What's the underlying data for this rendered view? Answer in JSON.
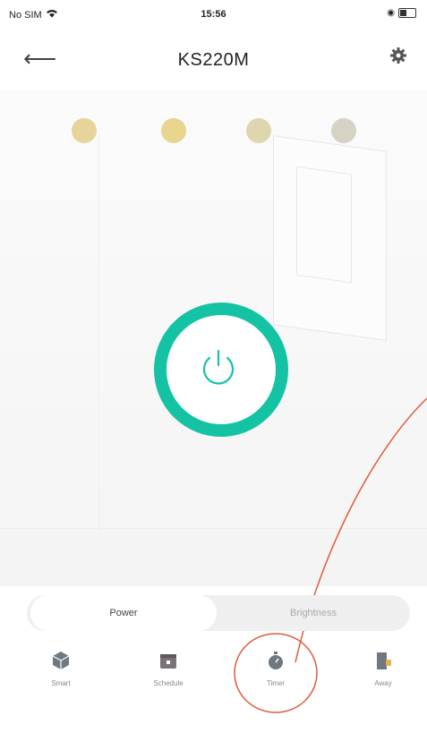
{
  "status_bar": {
    "carrier": "No SIM",
    "time": "15:56"
  },
  "header": {
    "title": "KS220M",
    "back_icon": "arrow-left-icon",
    "settings_icon": "gear-icon"
  },
  "indicator_dots": [
    "#e6d49a",
    "#e8d58e",
    "#dfd6b0",
    "#d7d3c4"
  ],
  "power": {
    "accent_color": "#14c2a4",
    "icon": "power-icon"
  },
  "tabs": [
    {
      "label": "Power",
      "selected": true
    },
    {
      "label": "Brightness",
      "selected": false
    }
  ],
  "bottom_nav": [
    {
      "label": "Smart",
      "icon": "smart-cube-icon"
    },
    {
      "label": "Schedule",
      "icon": "calendar-icon"
    },
    {
      "label": "Timer",
      "icon": "stopwatch-icon"
    },
    {
      "label": "Away",
      "icon": "away-door-icon"
    }
  ],
  "annotation_color": "#e05a3a"
}
